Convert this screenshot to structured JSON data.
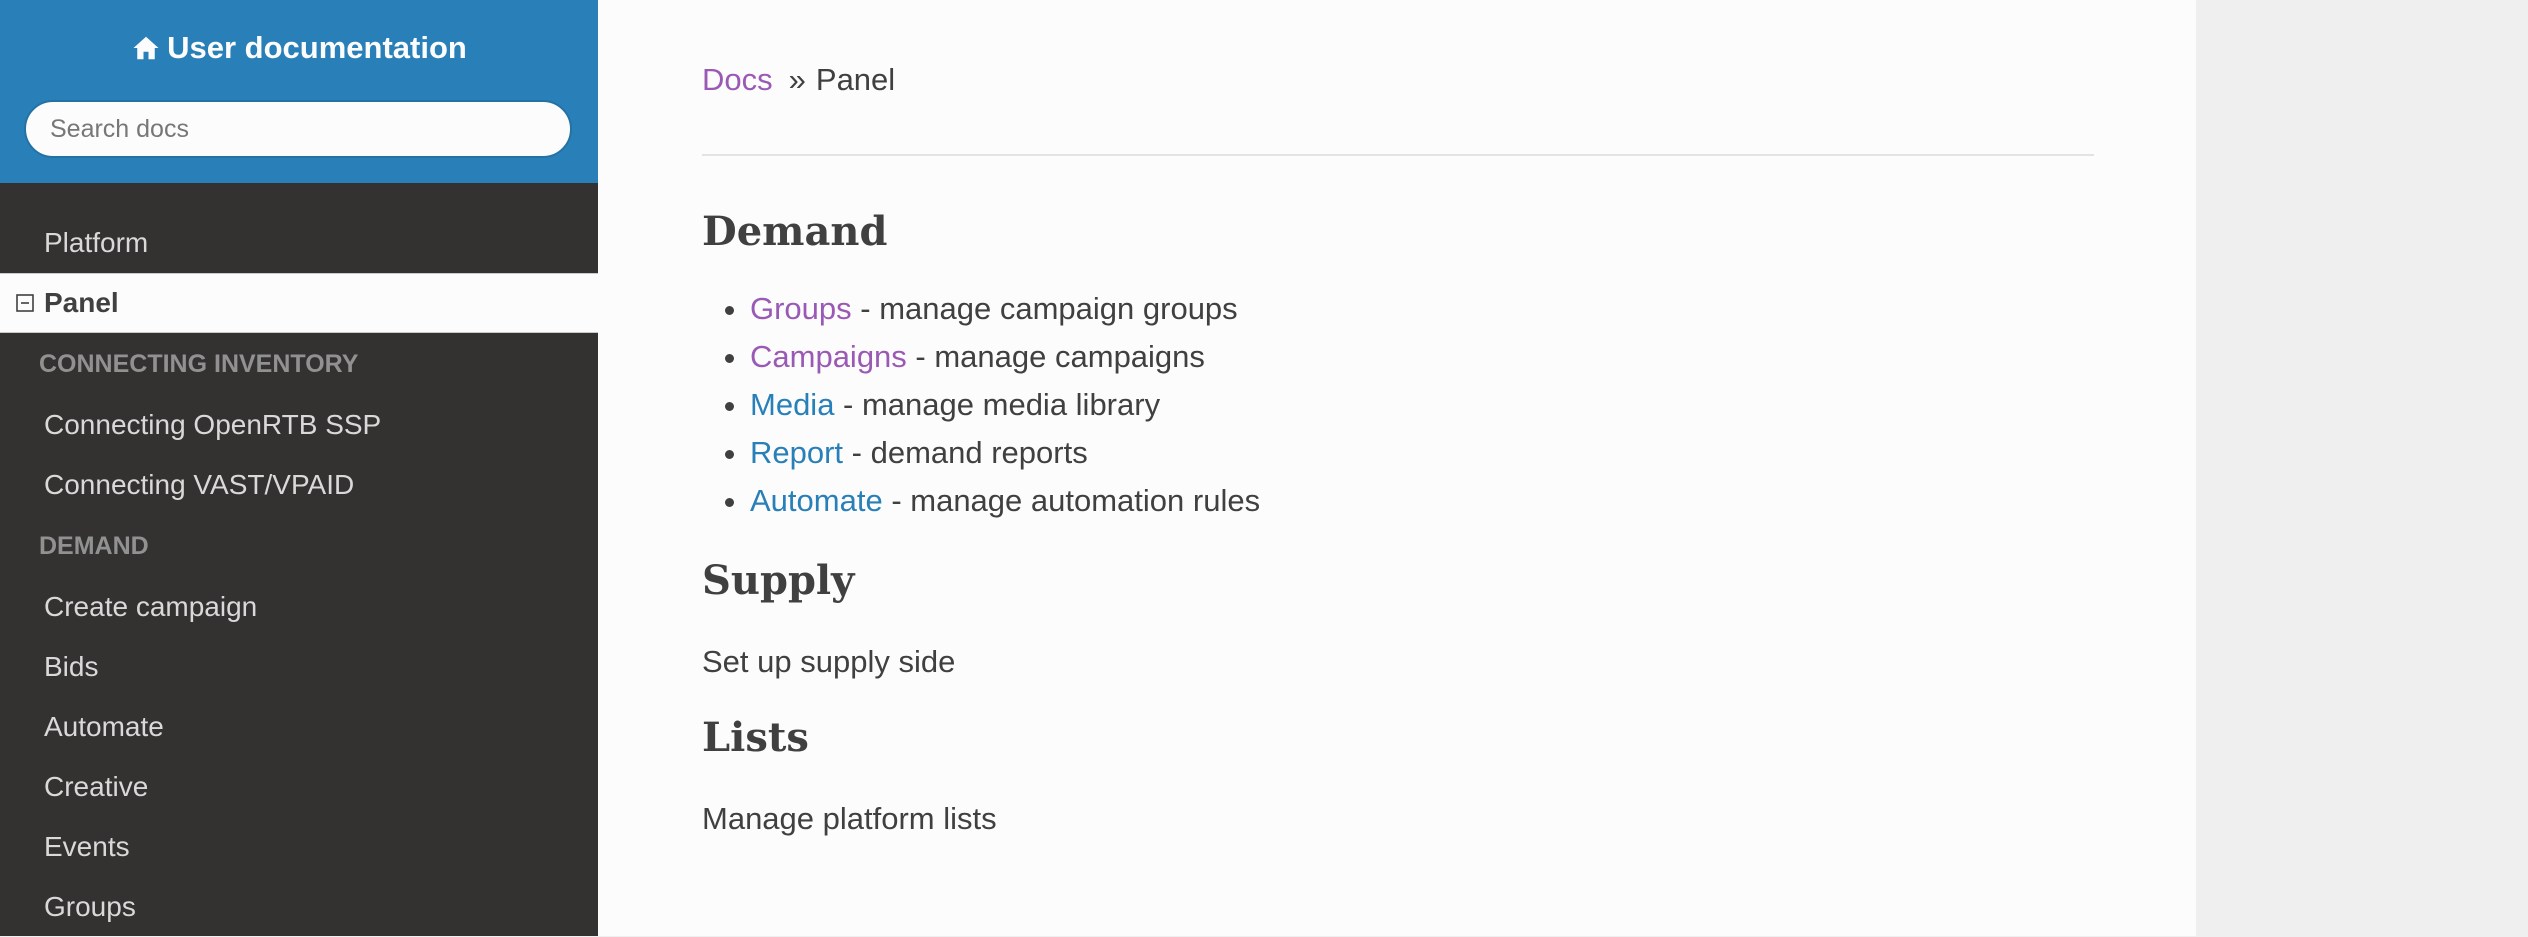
{
  "sidebar": {
    "project_title": "User documentation",
    "search_placeholder": "Search docs",
    "items": {
      "platform": "Platform",
      "panel": "Panel",
      "caption_connecting": "CONNECTING INVENTORY",
      "openrtb": "Connecting OpenRTB SSP",
      "vast": "Connecting VAST/VPAID",
      "caption_demand": "DEMAND",
      "create_campaign": "Create campaign",
      "bids": "Bids",
      "automate": "Automate",
      "creative": "Creative",
      "events": "Events",
      "groups": "Groups"
    }
  },
  "breadcrumb": {
    "docs": "Docs",
    "separator": "»",
    "current": "Panel"
  },
  "content": {
    "demand_heading": "Demand",
    "demand_items": [
      {
        "link": "Groups",
        "text": " - manage campaign groups"
      },
      {
        "link": "Campaigns",
        "text": " - manage campaigns"
      },
      {
        "link": "Media",
        "text": " - manage media library"
      },
      {
        "link": "Report",
        "text": " - demand reports"
      },
      {
        "link": "Automate",
        "text": " - manage automation rules"
      }
    ],
    "supply_heading": "Supply",
    "supply_text": "Set up supply side",
    "lists_heading": "Lists",
    "lists_text": "Manage platform lists"
  },
  "colors": {
    "sidebar_top": "#2980b9",
    "sidebar_bg": "#343131",
    "link": "#2980b9",
    "visited_link": "#9b59b6"
  }
}
